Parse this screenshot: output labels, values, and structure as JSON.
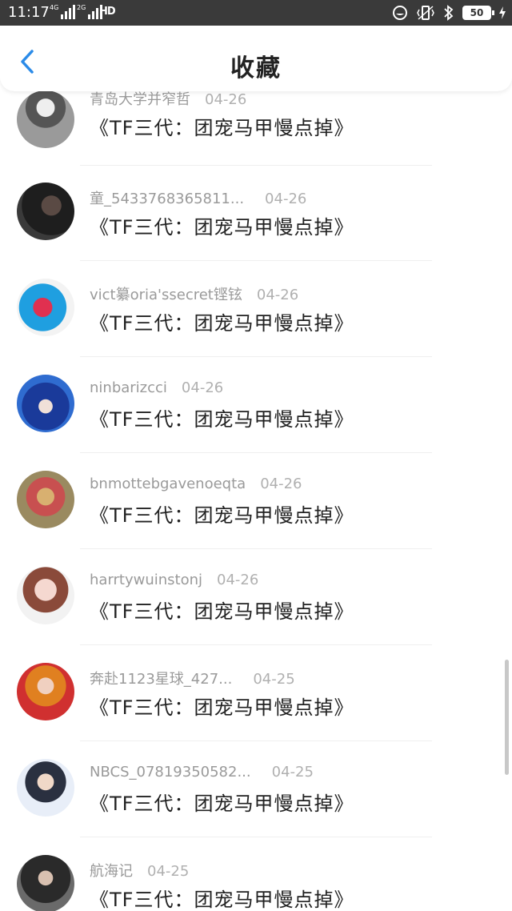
{
  "status_bar": {
    "time": "11:17",
    "net1": "4G",
    "net2": "2G",
    "hd": "HD",
    "battery": "50"
  },
  "header": {
    "title": "收藏"
  },
  "colors": {
    "accent": "#2b8be8",
    "status_bg": "#3a3a3a"
  },
  "items": [
    {
      "user": "青岛大学并窄哲",
      "date": "04-26",
      "book": "《TF三代：团宠马甲慢点掉》"
    },
    {
      "user": "童_5433768365811...",
      "date": "04-26",
      "book": "《TF三代：团宠马甲慢点掉》"
    },
    {
      "user": "vict纂oria'ssecret铿铉",
      "date": "04-26",
      "book": "《TF三代：团宠马甲慢点掉》"
    },
    {
      "user": "ninbarizcci",
      "date": "04-26",
      "book": "《TF三代：团宠马甲慢点掉》"
    },
    {
      "user": "bnmottebgavenoeqta",
      "date": "04-26",
      "book": "《TF三代：团宠马甲慢点掉》"
    },
    {
      "user": "harrtywuinstonj",
      "date": "04-26",
      "book": "《TF三代：团宠马甲慢点掉》"
    },
    {
      "user": "奔赴1123星球_427...",
      "date": "04-25",
      "book": "《TF三代：团宠马甲慢点掉》"
    },
    {
      "user": "NBCS_07819350582...",
      "date": "04-25",
      "book": "《TF三代：团宠马甲慢点掉》"
    },
    {
      "user": "航海记",
      "date": "04-25",
      "book": "《TF三代：团宠马甲慢点掉》"
    }
  ]
}
